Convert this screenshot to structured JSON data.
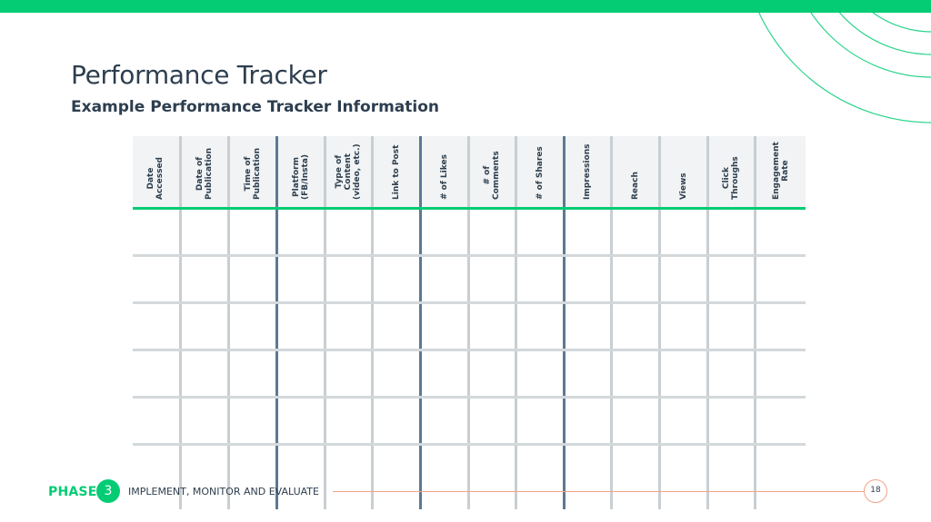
{
  "slide": {
    "title": "Performance Tracker",
    "subtitle": "Example Performance Tracker Information",
    "accent_color": "#03cc75",
    "text_color": "#2d3e4e"
  },
  "table": {
    "columns": [
      {
        "label": "Date\nAccessed"
      },
      {
        "label": "Date of\nPublication"
      },
      {
        "label": "Time of\nPublication"
      },
      {
        "label": "Platform\n(FB/Insta)"
      },
      {
        "label": "Type of\nContent\n(video, etc.)"
      },
      {
        "label": "Link to Post"
      },
      {
        "label": "# of Likes"
      },
      {
        "label": "# of\nComments"
      },
      {
        "label": "# of Shares"
      },
      {
        "label": "Impressions"
      },
      {
        "label": "Reach"
      },
      {
        "label": "Views"
      },
      {
        "label": "Click\nThroughs"
      },
      {
        "label": "Engagement\nRate"
      }
    ],
    "rows": [
      [
        "",
        "",
        "",
        "",
        "",
        "",
        "",
        "",
        "",
        "",
        "",
        "",
        "",
        ""
      ],
      [
        "",
        "",
        "",
        "",
        "",
        "",
        "",
        "",
        "",
        "",
        "",
        "",
        "",
        ""
      ],
      [
        "",
        "",
        "",
        "",
        "",
        "",
        "",
        "",
        "",
        "",
        "",
        "",
        "",
        ""
      ],
      [
        "",
        "",
        "",
        "",
        "",
        "",
        "",
        "",
        "",
        "",
        "",
        "",
        "",
        ""
      ],
      [
        "",
        "",
        "",
        "",
        "",
        "",
        "",
        "",
        "",
        "",
        "",
        "",
        "",
        ""
      ],
      [
        "",
        "",
        "",
        "",
        "",
        "",
        "",
        "",
        "",
        "",
        "",
        "",
        "",
        ""
      ]
    ]
  },
  "footer": {
    "phase_label": "PHASE",
    "phase_number": "3",
    "phase_name": "IMPLEMENT, MONITOR AND EVALUATE",
    "page_number": "18"
  }
}
